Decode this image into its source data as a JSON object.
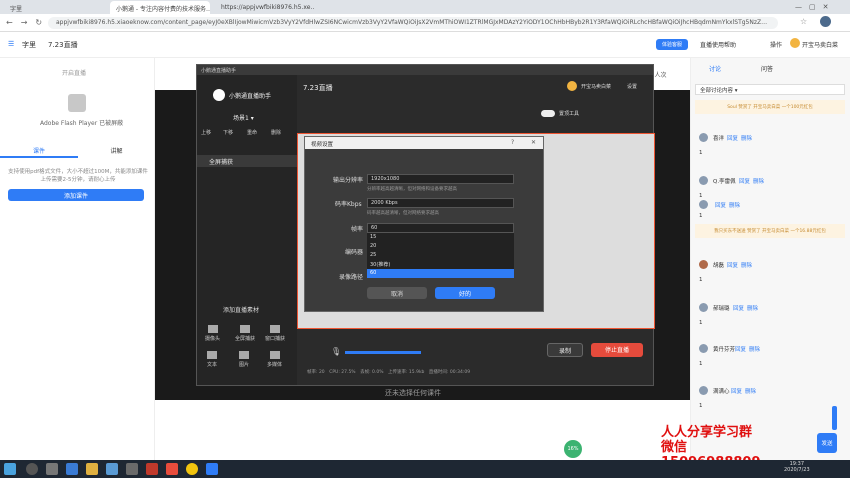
{
  "browser": {
    "tabs": [
      {
        "label": "字里",
        "active": false
      },
      {
        "label": "小鹅通 - 专注内容付费的技术服务…",
        "active": true
      },
      {
        "label": "https://appjvwfbiki8976.h5.xe…",
        "active": false
      }
    ],
    "url": "appjvwfbiki8976.h5.xiaoeknow.com/content_page/eyJ0eXBlIjowMiwicmVzb3VyY2VfdHlwZSI6NCwicmVzb3VyY2VfaWQiOiJsX2VmMThiOWI1ZTRlMGJxMDAzY2YiODY1OChHbHByb2R1Y3RfaWQiOiRLchcHBfaWQiOiJhcHBqdmNmYkxlSTg5NzZ…"
  },
  "app": {
    "brand": "字里",
    "title": "7.23直播",
    "header_actions": [
      "体验客服",
      "直播使用帮助",
      "操作",
      "开宝马卖白菜"
    ],
    "flash_notice_top": "开启直播",
    "flash_label": "Adobe Flash Player 已被屏蔽",
    "tabs": [
      "课件",
      "讲解"
    ],
    "upload_tip": "支持使用pdf格式文件，大小不超过100M，共能添加课件上传需要2-5分钟，请耐心上传",
    "add_button": "添加课件",
    "stage_hint": "还未选择任何课件",
    "viewers": "976人次"
  },
  "obs": {
    "window_title": "小鹅通直播助手",
    "logo_text": "小鹅通直播助手",
    "live_title": "7.23直播",
    "user": "开宝马卖白菜",
    "settings": "设置",
    "scene_label": "场景1",
    "scene_controls": [
      "上移",
      "下移",
      "重命",
      "删除"
    ],
    "source_item": "全屏捕获",
    "top_toggle": "置顶工具",
    "add_source": "添加直播素材",
    "sources": [
      "摄像头",
      "全屏捕获",
      "窗口捕获",
      "文本",
      "图片",
      "多媒体"
    ],
    "record_button": "录制",
    "stop_button": "停止直播",
    "status": [
      "帧率: 20",
      "CPU: 27.5%",
      "丢帧: 0.0%",
      "上传速率: 15.9kb",
      "直播时间: 00:34:09"
    ]
  },
  "dialog": {
    "title": "视频设置",
    "resolution_label": "输出分辨率",
    "resolution_value": "1920x1080",
    "resolution_note": "分辨率越高越清晰，但对网络和设备要求越高",
    "bitrate_label": "码率Kbps",
    "bitrate_value": "2000 Kbps",
    "bitrate_note": "码率越高越清晰，但对网络要求越高",
    "fps_label": "帧率",
    "fps_value": "60",
    "encoder_label": "编码器",
    "record_path_label": "录像路径",
    "fps_options": [
      "15",
      "20",
      "25",
      "30(推荐)",
      "60"
    ],
    "fps_selected": "60",
    "cancel": "取消",
    "ok": "好的"
  },
  "comments_panel": {
    "tabs": [
      "讨论",
      "问答"
    ],
    "filter": "全部讨论内容",
    "gift1": "Soul 赞赏了 开宝马卖白菜 一个100元红包",
    "gift2": "我只买东不送送 赞赏了 开宝马卖白菜 一个16.88元红包",
    "send": "发送",
    "comments": [
      {
        "name": "喜洋",
        "reply": "回复",
        "del": "删除",
        "text": "1"
      },
      {
        "name": "Q.李雷佩",
        "reply": "回复",
        "del": "删除",
        "text": "1"
      },
      {
        "name": "",
        "reply": "回复",
        "del": "删除",
        "text": "1"
      },
      {
        "name": "胡磊",
        "reply": "回复",
        "del": "删除",
        "text": "1"
      },
      {
        "name": "郝瑞璐",
        "reply": "回复",
        "del": "删除",
        "text": "1"
      },
      {
        "name": "黄丹芬芳",
        "reply": "回复",
        "del": "删除",
        "text": "1"
      },
      {
        "name": "满满心",
        "reply": "回复",
        "del": "删除",
        "text": "1"
      }
    ]
  },
  "taskbar": {
    "time": "19:37",
    "date": "2020/7/23",
    "cpu": "16%"
  },
  "watermark": [
    "人人分享学习群",
    "微信15096988809"
  ],
  "colors": {
    "accent": "#2f7cf6",
    "danger": "#e54b3c"
  }
}
